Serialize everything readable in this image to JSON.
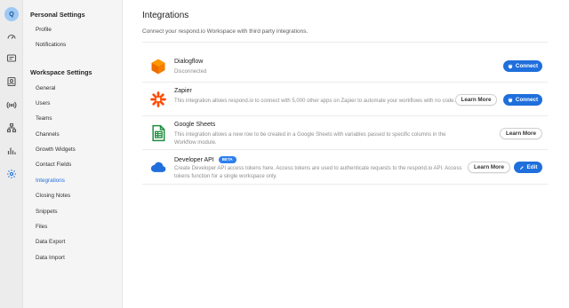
{
  "rail": {
    "avatar_initial": "Q",
    "icons": [
      "dashboard-icon",
      "messages-icon",
      "contacts-icon",
      "broadcast-icon",
      "workflows-icon",
      "reports-icon",
      "settings-icon"
    ]
  },
  "nav": {
    "personal_heading": "Personal Settings",
    "personal_items": [
      "Profile",
      "Notifications"
    ],
    "workspace_heading": "Workspace Settings",
    "workspace_items": [
      "General",
      "Users",
      "Teams",
      "Channels",
      "Growth Widgets",
      "Contact Fields",
      "Integrations",
      "Closing Notes",
      "Snippets",
      "Files",
      "Data Export",
      "Data Import"
    ],
    "active_item": "Integrations"
  },
  "page": {
    "title": "Integrations",
    "subtitle": "Connect your respond.io Workspace with third party integrations."
  },
  "integrations": [
    {
      "name": "Dialogflow",
      "description": "Disconnected",
      "icon": "dialogflow-logo-icon",
      "actions": {
        "connect": "Connect"
      }
    },
    {
      "name": "Zapier",
      "description": "This integration allows respond.io to connect with 5,000 other apps on Zapier to automate your workflows with no code.",
      "icon": "zapier-logo-icon",
      "actions": {
        "learn_more": "Learn More",
        "connect": "Connect"
      }
    },
    {
      "name": "Google Sheets",
      "description": "This integration allows a new row to be created in a Google Sheets with variables passed to specific columns in the Workflow module.",
      "icon": "google-sheets-logo-icon",
      "actions": {
        "learn_more": "Learn More"
      }
    },
    {
      "name": "Developer API",
      "badge": "BETA",
      "description": "Create Developer API access tokens here. Access tokens are used to authenticate requests to the respond.io API. Access tokens function for a single workspace only.",
      "icon": "cloud-icon",
      "actions": {
        "learn_more": "Learn More",
        "edit": "Edit"
      }
    }
  ],
  "colors": {
    "accent": "#1f6fdc",
    "dialogflow": "#f57c00",
    "zapier": "#ff4a00",
    "sheets": "#1e8e3e",
    "cloud": "#1f6fdc"
  }
}
